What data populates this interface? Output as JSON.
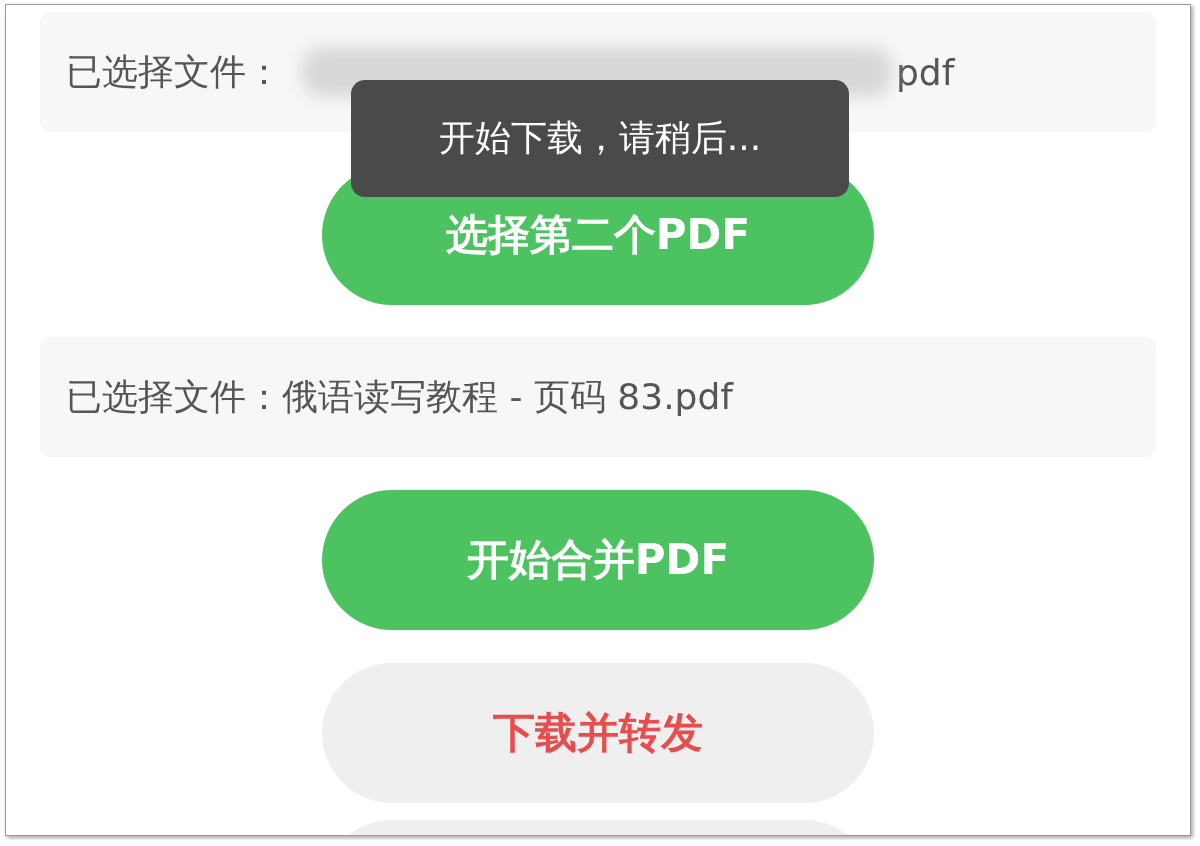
{
  "sections": [
    {
      "kind": "file",
      "label": "已选择文件：",
      "name": "pdf",
      "redacted": true
    },
    {
      "kind": "primary-button",
      "label": "选择第二个PDF"
    },
    {
      "kind": "file",
      "label": "已选择文件：",
      "name": "俄语读写教程 - 页码 83.pdf",
      "redacted": false
    },
    {
      "kind": "primary-button",
      "label": "开始合并PDF"
    },
    {
      "kind": "secondary-button",
      "label": "下载并转发"
    },
    {
      "kind": "secondary-button"
    }
  ],
  "toast": {
    "text": "开始下载，请稍后..."
  }
}
